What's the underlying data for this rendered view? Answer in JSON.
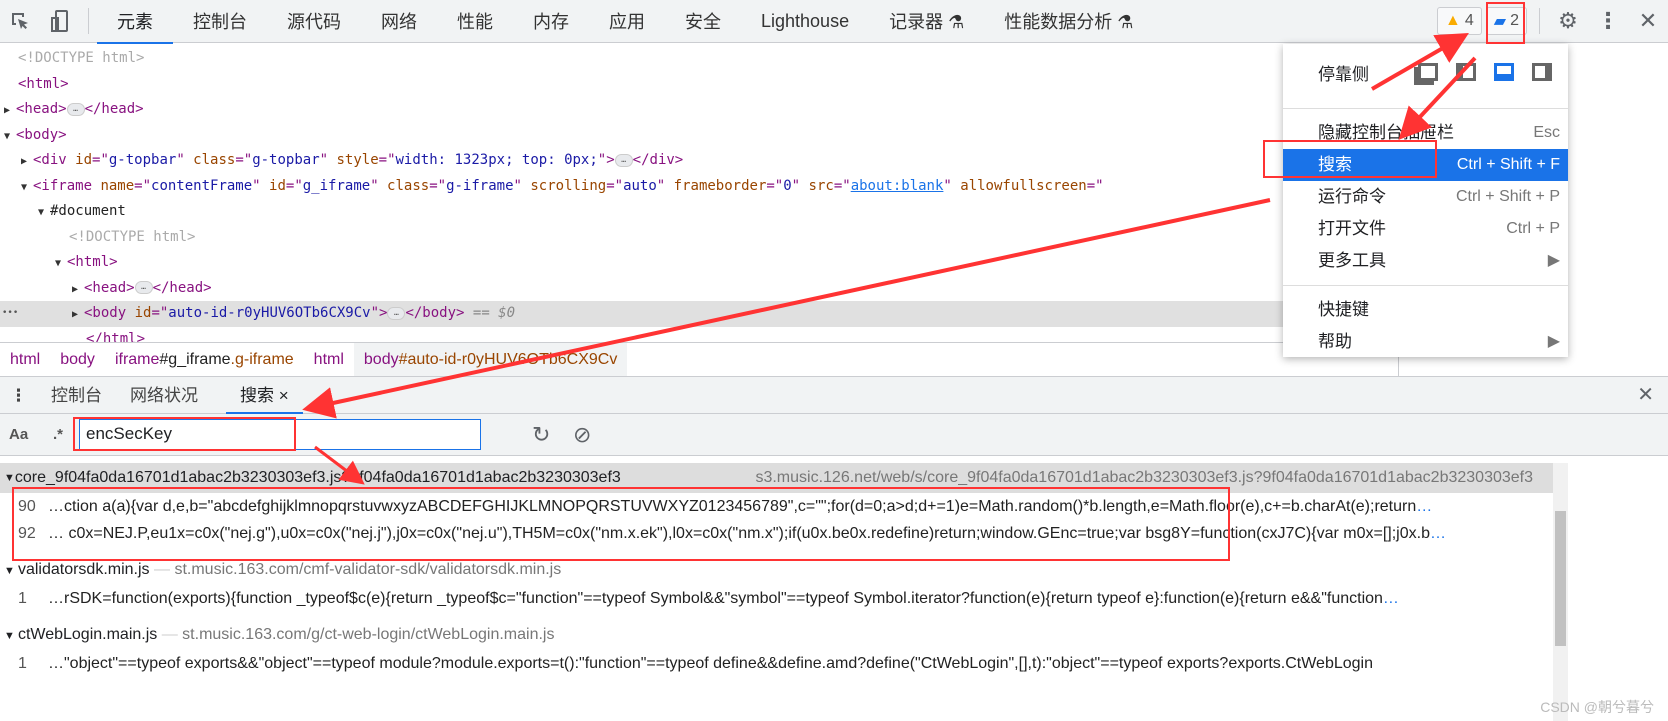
{
  "toolbar": {
    "tabs": [
      "元素",
      "控制台",
      "源代码",
      "网络",
      "性能",
      "内存",
      "应用",
      "安全",
      "Lighthouse",
      "记录器 ⚗",
      "性能数据分析 ⚗"
    ],
    "warnings": "4",
    "messages": "2"
  },
  "dom_lines": [
    {
      "indent": 0,
      "toggle": "",
      "parts": [
        [
          "gray",
          "<!DOCTYPE html>"
        ]
      ]
    },
    {
      "indent": 0,
      "toggle": "",
      "parts": [
        [
          "tag",
          "<html>"
        ]
      ]
    },
    {
      "indent": 0,
      "toggle": "▶",
      "parts": [
        [
          "tag",
          "<head>"
        ],
        [
          "ell",
          "…"
        ],
        [
          "tag",
          "</head>"
        ]
      ]
    },
    {
      "indent": 0,
      "toggle": "▼",
      "parts": [
        [
          "tag",
          "<body>"
        ]
      ]
    },
    {
      "indent": 1,
      "toggle": "▶",
      "parts": [
        [
          "tag",
          "<div "
        ],
        [
          "an",
          "id"
        ],
        [
          "tag",
          "=\""
        ],
        [
          "av",
          "g-topbar"
        ],
        [
          "tag",
          "\" "
        ],
        [
          "an",
          "class"
        ],
        [
          "tag",
          "=\""
        ],
        [
          "av",
          "g-topbar"
        ],
        [
          "tag",
          "\" "
        ],
        [
          "an",
          "style"
        ],
        [
          "tag",
          "=\""
        ],
        [
          "av",
          "width: 1323px; top: 0px;"
        ],
        [
          "tag",
          "\">"
        ],
        [
          "ell",
          "…"
        ],
        [
          "tag",
          "</div>"
        ]
      ]
    },
    {
      "indent": 1,
      "toggle": "▼",
      "parts": [
        [
          "tag",
          "<iframe "
        ],
        [
          "an",
          "name"
        ],
        [
          "tag",
          "=\""
        ],
        [
          "av",
          "contentFrame"
        ],
        [
          "tag",
          "\" "
        ],
        [
          "an",
          "id"
        ],
        [
          "tag",
          "=\""
        ],
        [
          "av",
          "g_iframe"
        ],
        [
          "tag",
          "\" "
        ],
        [
          "an",
          "class"
        ],
        [
          "tag",
          "=\""
        ],
        [
          "av",
          "g-iframe"
        ],
        [
          "tag",
          "\" "
        ],
        [
          "an",
          "scrolling"
        ],
        [
          "tag",
          "=\""
        ],
        [
          "av",
          "auto"
        ],
        [
          "tag",
          "\" "
        ],
        [
          "an",
          "frameborder"
        ],
        [
          "tag",
          "=\""
        ],
        [
          "av",
          "0"
        ],
        [
          "tag",
          "\" "
        ],
        [
          "an",
          "src"
        ],
        [
          "tag",
          "=\""
        ],
        [
          "link",
          "about:blank"
        ],
        [
          "tag",
          "\" "
        ],
        [
          "an",
          "allowfullscreen"
        ],
        [
          "tag",
          "=\""
        ]
      ]
    },
    {
      "indent": 2,
      "toggle": "▼",
      "parts": [
        [
          "txt",
          "#document"
        ]
      ]
    },
    {
      "indent": 3,
      "toggle": "",
      "parts": [
        [
          "gray",
          "<!DOCTYPE html>"
        ]
      ]
    },
    {
      "indent": 3,
      "toggle": "▼",
      "parts": [
        [
          "tag",
          "<html>"
        ]
      ]
    },
    {
      "indent": 4,
      "toggle": "▶",
      "parts": [
        [
          "tag",
          "<head>"
        ],
        [
          "ell",
          "…"
        ],
        [
          "tag",
          "</head>"
        ]
      ]
    },
    {
      "indent": 4,
      "toggle": "▶",
      "sel": true,
      "parts": [
        [
          "tag",
          "<body "
        ],
        [
          "an",
          "id"
        ],
        [
          "tag",
          "=\""
        ],
        [
          "av",
          "auto-id-r0yHUV6OTb6CX9Cv"
        ],
        [
          "tag",
          "\">"
        ],
        [
          "ell",
          "…"
        ],
        [
          "tag",
          "</body>"
        ],
        [
          "eq",
          " == $0"
        ]
      ]
    },
    {
      "indent": 4,
      "toggle": "",
      "parts": [
        [
          "tag",
          "</html>"
        ]
      ]
    }
  ],
  "breadcrumbs": [
    "html",
    "body",
    "iframe#g_iframe.g-iframe",
    "html",
    "body#auto-id-r0yHUV6OTb6CX9Cv"
  ],
  "drawer": {
    "tabs": [
      "控制台",
      "网络状况",
      "搜索"
    ],
    "close": "×"
  },
  "search": {
    "case_label": "Aa",
    "regex_label": ".*",
    "query": "encSecKey"
  },
  "results": [
    {
      "file": "core_9f04fa0da16701d1abac2b3230303ef3.js?9f04fa0da16701d1abac2b3230303ef3",
      "url": "s3.music.126.net/web/s/core_9f04fa0da16701d1abac2b3230303ef3.js?9f04fa0da16701d1abac2b3230303ef3",
      "matches": [
        {
          "line": "90",
          "text": "…ction a(a){var d,e,b=\"abcdefghijklmnopqrstuvwxyzABCDEFGHIJKLMNOPQRSTUVWXYZ0123456789\",c=\"\";for(d=0;a>d;d+=1)e=Math.random()*b.length,e=Math.floor(e),c+=b.charAt(e);return "
        },
        {
          "line": "92",
          "text": "… c0x=NEJ.P,eu1x=c0x(\"nej.g\"),u0x=c0x(\"nej.j\"),j0x=c0x(\"nej.u\"),TH5M=c0x(\"nm.x.ek\"),l0x=c0x(\"nm.x\");if(u0x.be0x.redefine)return;window.GEnc=true;var bsg8Y=function(cxJ7C){var m0x=[];j0x.b"
        }
      ]
    },
    {
      "file": "validatorsdk.min.js",
      "url": "st.music.163.com/cmf-validator-sdk/validatorsdk.min.js",
      "matches": [
        {
          "line": "1",
          "text": "…rSDK=function(exports){function _typeof$c(e){return _typeof$c=\"function\"==typeof Symbol&&\"symbol\"==typeof Symbol.iterator?function(e){return typeof e}:function(e){return e&&\"function"
        }
      ]
    },
    {
      "file": "ctWebLogin.main.js",
      "url": "st.music.163.com/g/ct-web-login/ctWebLogin.main.js",
      "matches": [
        {
          "line": "1",
          "text": "…\"object\"==typeof exports&&\"object\"==typeof module?module.exports=t():\"function\"==typeof define&&define.amd?define(\"CtWebLogin\",[],t):\"object\"==typeof exports?exports.CtWebLogin"
        }
      ]
    }
  ],
  "more": "…",
  "menu": {
    "dock_label": "停靠侧",
    "items": [
      {
        "label": "隐藏控制台抽屉栏",
        "shortcut": "Esc"
      },
      {
        "label": "搜索",
        "shortcut": "Ctrl + Shift + F"
      },
      {
        "label": "运行命令",
        "shortcut": "Ctrl + Shift + P"
      },
      {
        "label": "打开文件",
        "shortcut": "Ctrl + P"
      },
      {
        "label": "更多工具",
        "shortcut": "▶"
      },
      {
        "label": "快捷键",
        "shortcut": ""
      },
      {
        "label": "帮助",
        "shortcut": "▶"
      }
    ]
  },
  "watermark": "CSDN @朝兮暮兮",
  "colors": {
    "accent": "#1a73e8",
    "annotation": "#ff3333",
    "tag": "#881280",
    "attr_name": "#994500",
    "attr_value": "#1a1aa6"
  }
}
